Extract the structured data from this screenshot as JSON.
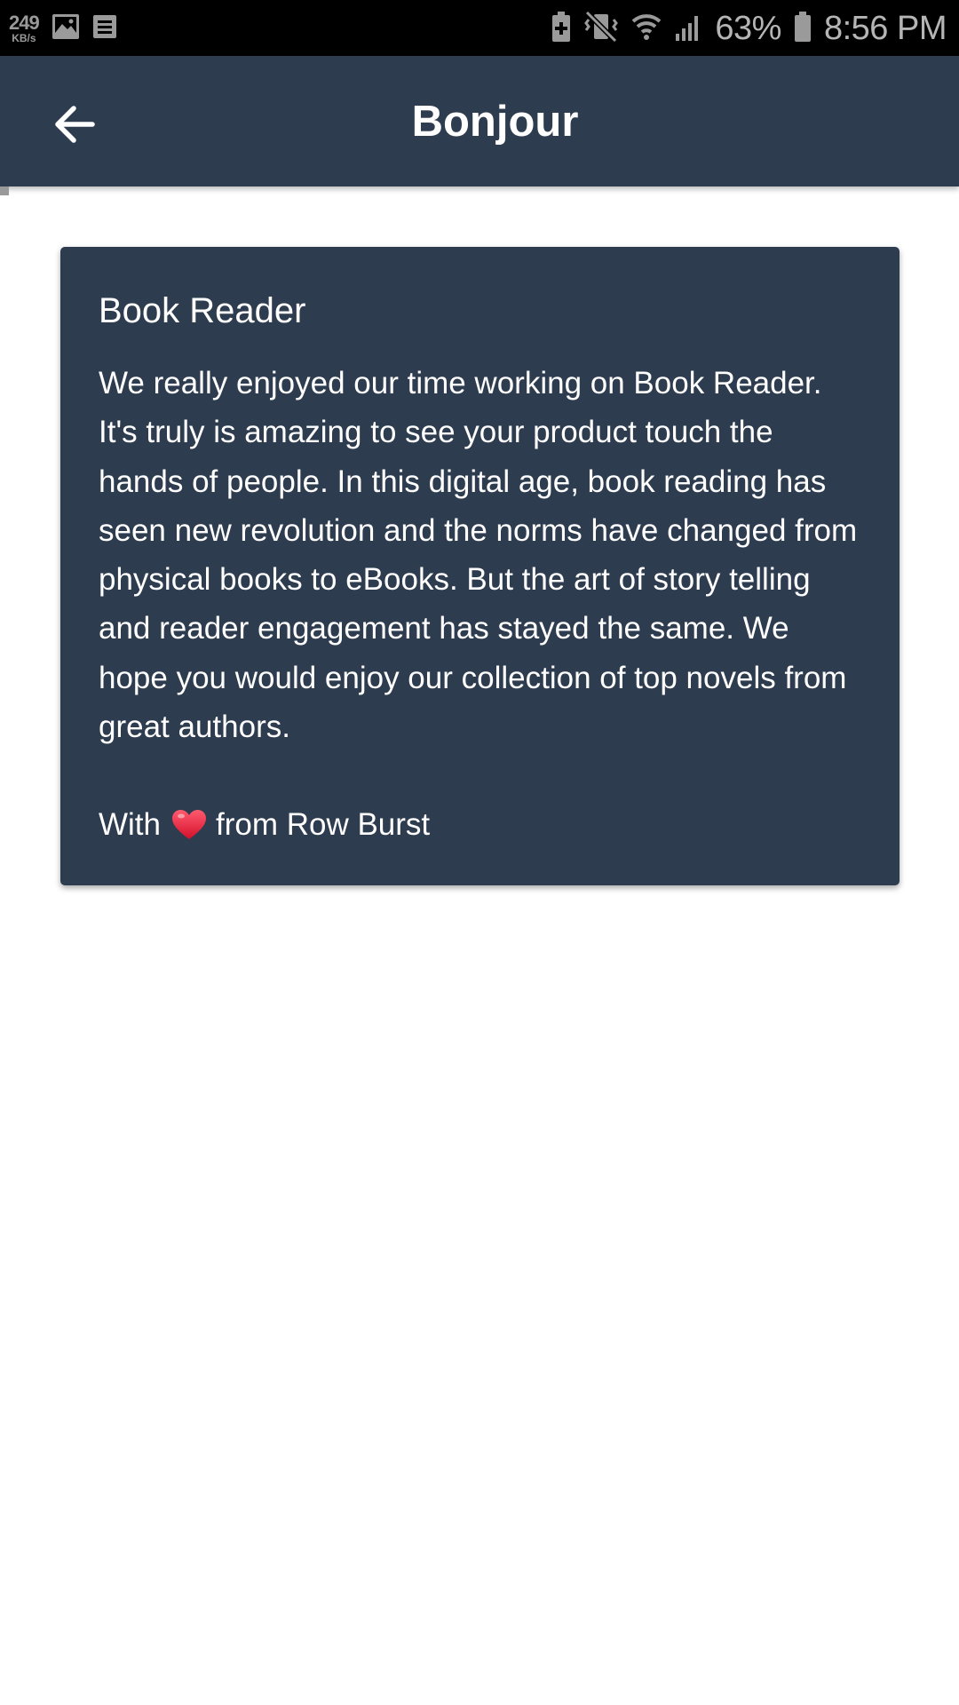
{
  "status_bar": {
    "net_speed_value": "249",
    "net_speed_unit": "KB/s",
    "battery_percent": "63%",
    "time": "8:56 PM",
    "icons": [
      "image-icon",
      "news-icon",
      "battery-saver-icon",
      "vibrate-mute-icon",
      "wifi-icon",
      "signal-icon",
      "battery-icon"
    ]
  },
  "app_bar": {
    "title": "Bonjour",
    "back_icon": "arrow-back-icon"
  },
  "card": {
    "title": "Book Reader",
    "body": "We really enjoyed our time working on Book Reader. It's truly is amazing to see your product touch the hands of people. In this digital age, book reading has seen new revolution and the norms have changed from physical books to eBooks. But the art of story telling and reader engagement has stayed the same. We hope you would enjoy our collection of top novels from great authors.",
    "sign_prefix": "With",
    "sign_suffix": "from Row Burst",
    "sign_icon": "heart-icon"
  },
  "colors": {
    "primary": "#2e3c50",
    "text_on_primary": "#ffffff",
    "heart": "#e8203a",
    "status_bar": "#000000"
  }
}
